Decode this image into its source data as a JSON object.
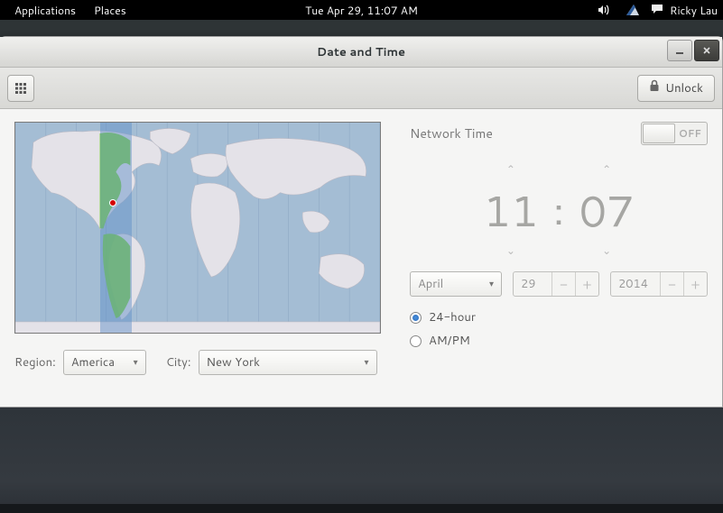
{
  "panel": {
    "applications": "Applications",
    "places": "Places",
    "clock": "Tue Apr 29, 11:07 AM",
    "user": "Ricky Lau"
  },
  "window": {
    "title": "Date and Time",
    "unlock": "Unlock"
  },
  "map": {
    "region_label": "Region:",
    "region_value": "America",
    "city_label": "City:",
    "city_value": "New York"
  },
  "settings": {
    "network_time_label": "Network Time",
    "network_time_state": "OFF",
    "hour": "11",
    "minute": "07",
    "month": "April",
    "day": "29",
    "year": "2014",
    "fmt24": "24-hour",
    "fmtAmPm": "AM/PM",
    "format_selected": "24"
  }
}
